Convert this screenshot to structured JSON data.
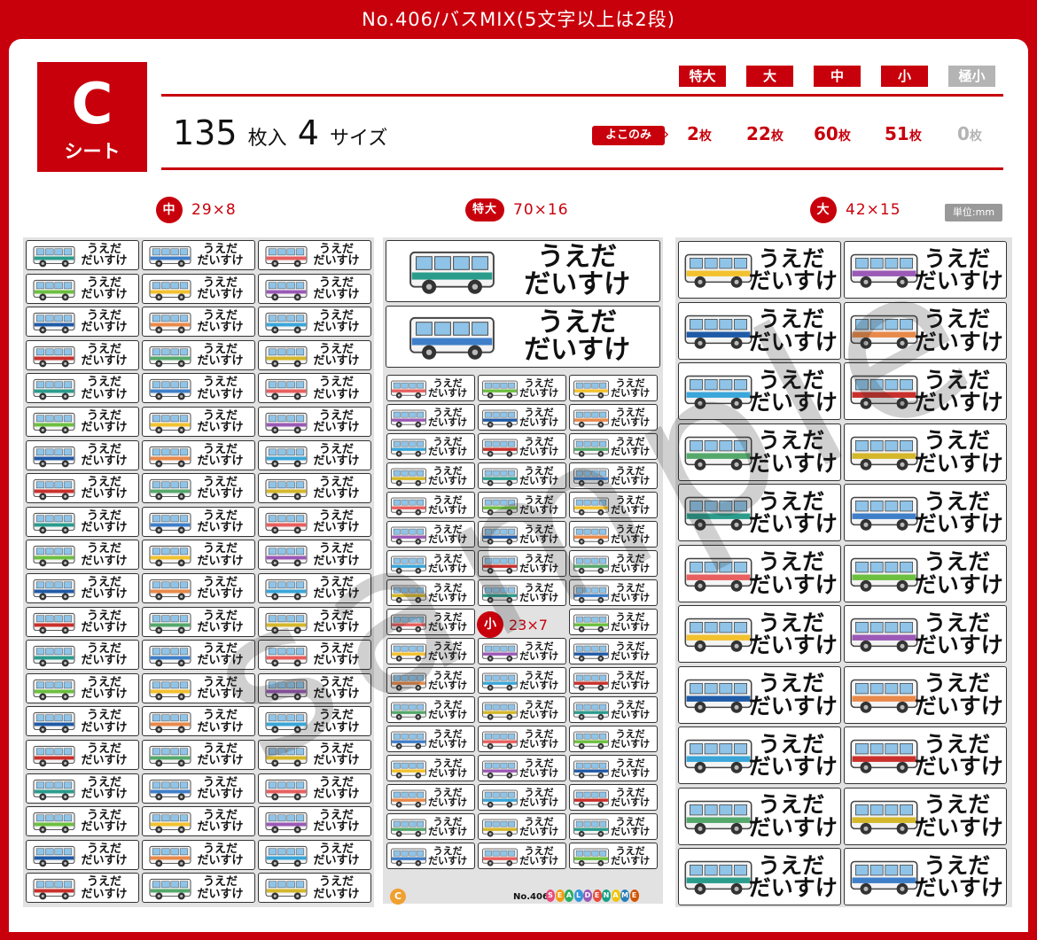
{
  "header": {
    "title": "No.406/バスMIX(5文字以上は2段)"
  },
  "sheet_badge": {
    "letter": "C",
    "word": "シート"
  },
  "summary": {
    "count": "135",
    "count_unit": "枚入",
    "sizes": "4",
    "sizes_unit": "サイズ"
  },
  "size_badges": [
    {
      "label": "特大",
      "count": "2",
      "enabled": true
    },
    {
      "label": "大",
      "count": "22",
      "enabled": true
    },
    {
      "label": "中",
      "count": "60",
      "enabled": true
    },
    {
      "label": "小",
      "count": "51",
      "enabled": true
    },
    {
      "label": "極小",
      "count": "0",
      "enabled": false
    }
  ],
  "count_unit": "枚",
  "orientation_label": "よこのみ",
  "sections": {
    "medium": {
      "badge": "中",
      "dims": "29×8"
    },
    "xl": {
      "badge": "特大",
      "dims": "70×16"
    },
    "large": {
      "badge": "大",
      "dims": "42×15"
    },
    "small": {
      "badge": "小",
      "dims": "23×7"
    }
  },
  "unit_label": "単位:mm",
  "label_name": {
    "line1": "うえだ",
    "line2": "だいすけ"
  },
  "watermark": "sample",
  "footer": {
    "sheet_mark": "C",
    "number": "No.406",
    "logo": "SEALDENAME"
  },
  "bus_colors": [
    "#2b9c8c",
    "#3f7fc9",
    "#e85f5f",
    "#6cbf3f",
    "#f2c12e",
    "#9b59b6",
    "#1f5aa6",
    "#e8894a",
    "#3aa6d9",
    "#c9302c",
    "#55a86b",
    "#d4b72b"
  ],
  "logo_colors": [
    "#e84c7d",
    "#f39c12",
    "#27ae60",
    "#3498db",
    "#9b59b6",
    "#e74c3c",
    "#16a085",
    "#f1c40f",
    "#2980b9",
    "#d35400"
  ]
}
